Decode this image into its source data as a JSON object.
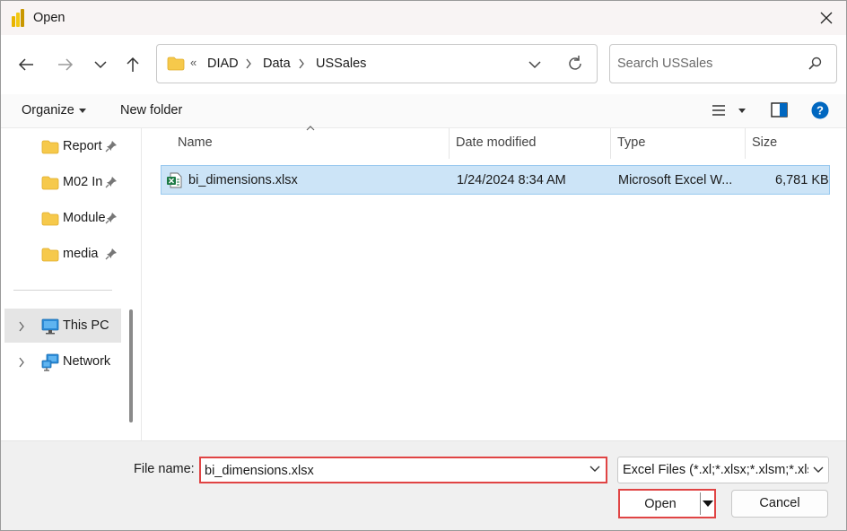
{
  "window": {
    "title": "Open"
  },
  "address": {
    "overflow_glyph": "«",
    "crumbs": [
      "DIAD",
      "Data",
      "USSales"
    ]
  },
  "search": {
    "placeholder": "Search USSales"
  },
  "toolbar": {
    "organize_label": "Organize",
    "new_folder_label": "New folder"
  },
  "sidebar": {
    "pinned": [
      {
        "label": "Report"
      },
      {
        "label": "M02 In"
      },
      {
        "label": "Module"
      },
      {
        "label": "media"
      }
    ],
    "locations": [
      {
        "label": "This PC"
      },
      {
        "label": "Network"
      }
    ]
  },
  "file_list": {
    "columns": [
      "Name",
      "Date modified",
      "Type",
      "Size"
    ],
    "rows": [
      {
        "name": "bi_dimensions.xlsx",
        "date_modified": "1/24/2024 8:34 AM",
        "type": "Microsoft Excel W...",
        "size": "6,781 KB"
      }
    ]
  },
  "bottom": {
    "file_name_label": "File name:",
    "file_name_value": "bi_dimensions.xlsx",
    "file_type_value": "Excel Files (*.xl;*.xlsx;*.xlsm;*.xlsb",
    "open_label": "Open",
    "cancel_label": "Cancel"
  },
  "colors": {
    "selection": "#cce4f7",
    "selection_border": "#99c9ef",
    "highlight_red": "#e04444",
    "help_blue": "#0067c0",
    "folder_yellow": "#f6c94b"
  }
}
